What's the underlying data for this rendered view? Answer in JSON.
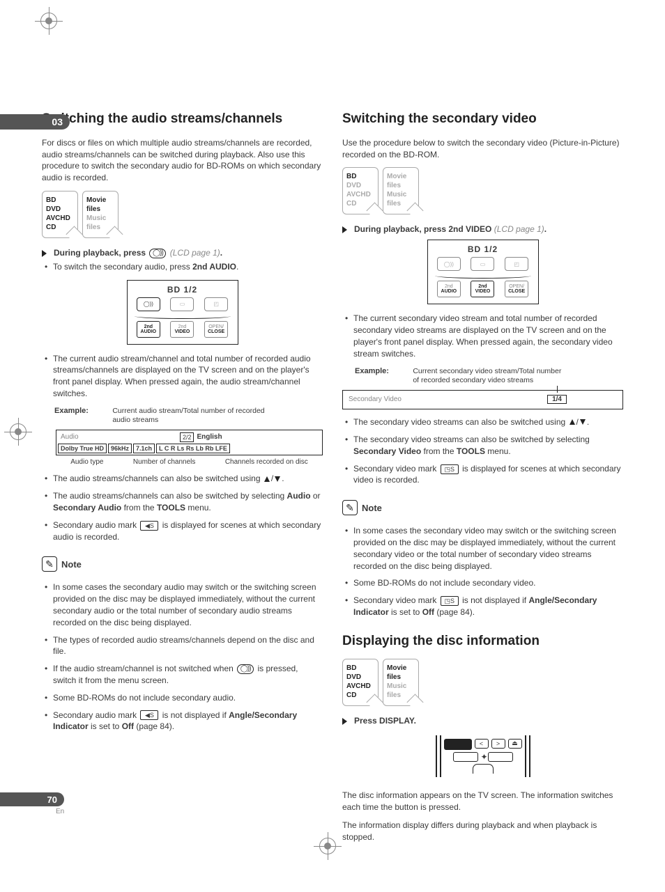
{
  "chapter": "03",
  "page_number": "70",
  "language_code": "En",
  "left": {
    "heading": "Switching the audio streams/channels",
    "intro": "For discs or files on which multiple audio streams/channels are recorded, audio streams/channels can be switched during playback. Also use this procedure to switch the secondary audio for BD-ROMs on which secondary audio is recorded.",
    "badges": {
      "col1": [
        "BD",
        "DVD",
        "AVCHD",
        "CD"
      ],
      "col2_bold": "Movie files",
      "col2_grey": "Music files"
    },
    "step1_label": "During playback, press",
    "step1_ref": "(LCD page 1)",
    "step1_sub": "To switch the secondary audio, press",
    "step1_sub_b": "2nd AUDIO",
    "remote": {
      "title": "BD   1/2",
      "row2": [
        {
          "l1": "2nd",
          "l2": "AUDIO",
          "active": true
        },
        {
          "l1": "2nd",
          "l2": "VIDEO",
          "active": false
        },
        {
          "l1": "OPEN/",
          "l2": "CLOSE",
          "active": false
        }
      ]
    },
    "after_remote": "The current audio stream/channel and total number of recorded audio streams/channels are displayed on the TV screen and on the player's front panel display. When pressed again, the audio stream/channel switches.",
    "example_label": "Example:",
    "example_desc": "Current audio stream/Total number of recorded audio streams",
    "diagram": {
      "audio_label": "Audio",
      "counter": "2/2",
      "lang": "English",
      "cells": [
        "Dolby True HD",
        "96kHz",
        "7.1ch",
        "L C R Ls Rs Lb Rb LFE"
      ],
      "annos": [
        "Audio type",
        "Number of channels",
        "Channels recorded on disc"
      ]
    },
    "bullets": [
      {
        "pre": "The audio streams/channels can also be switched using ",
        "icons": "updown",
        "post": "."
      },
      {
        "pre": "The audio streams/channels can also be switched by selecting ",
        "b1": "Audio",
        "mid": " or ",
        "b2": "Secondary Audio",
        "mid2": " from the ",
        "b3": "TOOLS",
        "post": " menu."
      },
      {
        "pre": "Secondary audio mark ",
        "icon": "speaker-s",
        "post": " is displayed for scenes at which secondary audio is recorded."
      }
    ],
    "note_label": "Note",
    "notes": [
      "In some cases the secondary audio may switch or the switching screen provided on the disc may be displayed immediately, without the current secondary audio or the total number of secondary audio streams recorded on the disc being displayed.",
      "The types of recorded audio streams/channels depend on the disc and file.",
      {
        "pre": "If the audio stream/channel is not switched when ",
        "icon": "audio",
        "post": " is pressed, switch it from the menu screen."
      },
      "Some BD-ROMs do not include secondary audio.",
      {
        "pre": "Secondary audio mark ",
        "icon": "speaker-s",
        "mid": " is not displayed if ",
        "b1": "Angle/Secondary Indicator",
        "mid2": " is set to ",
        "b2": "Off",
        "post": " (page 84)."
      }
    ]
  },
  "right": {
    "heading": "Switching the secondary video",
    "intro": "Use the procedure below to switch the secondary video (Picture-in-Picture) recorded on the BD-ROM.",
    "badges": {
      "col1_bold": "BD",
      "col1_grey": [
        "DVD",
        "AVCHD",
        "CD"
      ],
      "col2_grey": [
        "Movie files",
        "Music files"
      ]
    },
    "step1_label": "During playback, press 2nd VIDEO",
    "step1_ref": "(LCD page 1)",
    "remote": {
      "title": "BD   1/2",
      "row2": [
        {
          "l1": "2nd",
          "l2": "AUDIO",
          "active": false
        },
        {
          "l1": "2nd",
          "l2": "VIDEO",
          "active": true
        },
        {
          "l1": "OPEN/",
          "l2": "CLOSE",
          "active": false
        }
      ]
    },
    "after_remote": "The current secondary video stream and total number of recorded secondary video streams are displayed on the TV screen and on the player's front panel display. When pressed again, the secondary video stream switches.",
    "example_label": "Example:",
    "example_desc": "Current secondary video stream/Total number of recorded secondary video streams",
    "diagram": {
      "label": "Secondary Video",
      "value": "1/4"
    },
    "bullets": [
      {
        "pre": "The secondary video streams can also be switched using ",
        "icons": "updown",
        "post": "."
      },
      {
        "pre": "The secondary video streams can also be switched by selecting ",
        "b1": "Secondary Video",
        "mid": " from the ",
        "b2": "TOOLS",
        "post": " menu."
      },
      {
        "pre": "Secondary video mark ",
        "icon": "pip-s",
        "post": " is displayed for scenes at which secondary video is recorded."
      }
    ],
    "note_label": "Note",
    "notes": [
      "In some cases the secondary video may switch or the switching screen provided on the disc may be displayed immediately, without the current secondary video or the total number of secondary video streams recorded on the disc being displayed.",
      "Some BD-ROMs do not include secondary video.",
      {
        "pre": "Secondary video mark ",
        "icon": "pip-s",
        "mid": " is not displayed if ",
        "b1": "Angle/Secondary Indicator",
        "mid2": " is set to ",
        "b2": "Off",
        "post": " (page 84)."
      }
    ],
    "heading2": "Displaying the disc information",
    "badges2": {
      "col1": [
        "BD",
        "DVD",
        "AVCHD",
        "CD"
      ],
      "col2_bold": "Movie files",
      "col2_grey": "Music files"
    },
    "step2_label": "Press DISPLAY.",
    "closing1": "The disc information appears on the TV screen. The information switches each time the button is pressed.",
    "closing2": "The information display differs during playback and when playback is stopped."
  }
}
